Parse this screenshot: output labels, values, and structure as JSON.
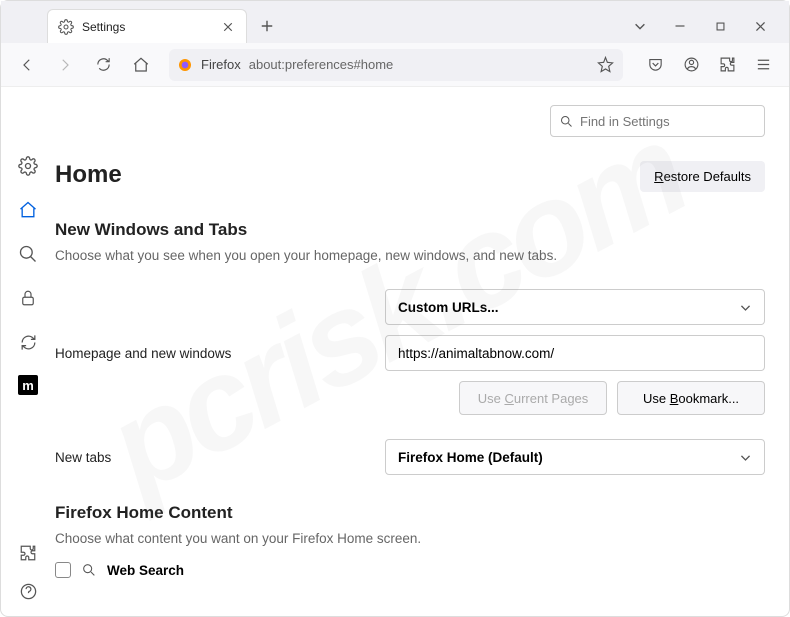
{
  "tab": {
    "title": "Settings"
  },
  "urlbar": {
    "identity": "Firefox",
    "url": "about:preferences#home"
  },
  "search": {
    "placeholder": "Find in Settings"
  },
  "page": {
    "title": "Home",
    "restore": "Restore Defaults"
  },
  "section1": {
    "title": "New Windows and Tabs",
    "desc": "Choose what you see when you open your homepage, new windows, and new tabs."
  },
  "homepage": {
    "label": "Homepage and new windows",
    "select": "Custom URLs...",
    "url": "https://animaltabnow.com/",
    "use_current": "Use Current Pages",
    "use_bookmark": "Use Bookmark..."
  },
  "newtabs": {
    "label": "New tabs",
    "select": "Firefox Home (Default)"
  },
  "section2": {
    "title": "Firefox Home Content",
    "desc": "Choose what content you want on your Firefox Home screen.",
    "websearch": "Web Search"
  }
}
